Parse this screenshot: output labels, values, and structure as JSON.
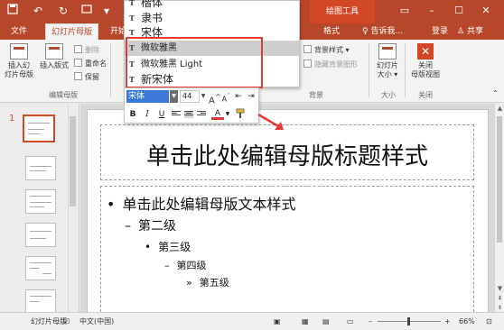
{
  "window": {
    "context_tool": "绘图工具"
  },
  "tabs": [
    {
      "label": "文件"
    },
    {
      "label": "幻灯片母版"
    },
    {
      "label": "开始"
    },
    {
      "label": "格式"
    },
    {
      "label": "告诉我..."
    },
    {
      "label": "登录"
    },
    {
      "label": "共享"
    }
  ],
  "ribbon": {
    "insert_slide_master": "插入幻灯片母版",
    "insert_slide_master_l1": "插入幻",
    "insert_slide_master_l2": "灯片母版",
    "insert_layout": "插入版式",
    "delete": "删除",
    "rename": "重命名",
    "preserve": "保留",
    "group_edit_master": "编辑母版",
    "bg_styles": "背景样式",
    "hide_bg_graphics": "隐藏背景图形",
    "group_background": "背景",
    "slide_size_l1": "幻灯片",
    "slide_size_l2": "大小",
    "group_size": "大小",
    "close_master_l1": "关闭",
    "close_master_l2": "母版视图",
    "group_close": "关闭"
  },
  "font_dropdown": {
    "items": [
      {
        "name": "楷体"
      },
      {
        "name": "隶书"
      },
      {
        "name": "宋体"
      },
      {
        "name": "微软雅黑"
      },
      {
        "name": "微软雅黑 Light"
      },
      {
        "name": "新宋体"
      }
    ],
    "highlighted": "微软雅黑"
  },
  "mini_toolbar": {
    "font": "宋体",
    "size": "44",
    "grow": "A",
    "shrink": "A",
    "bold": "B",
    "italic": "I",
    "underline": "U",
    "font_color": "A"
  },
  "thumbnails": {
    "current_number": "1"
  },
  "slide": {
    "title": "单击此处编辑母版标题样式",
    "levels": [
      {
        "marker": "•",
        "text": "单击此处编辑母版文本样式"
      },
      {
        "marker": "–",
        "text": "第二级"
      },
      {
        "marker": "•",
        "text": "第三级"
      },
      {
        "marker": "–",
        "text": "第四级"
      },
      {
        "marker": "»",
        "text": "第五级"
      }
    ]
  },
  "status": {
    "view": "幻灯片母版",
    "language": "中文(中国)",
    "zoom": "66%"
  },
  "colors": {
    "accent": "#b7472a",
    "highlight_box": "#e53935",
    "selection": "#3b78d8"
  }
}
